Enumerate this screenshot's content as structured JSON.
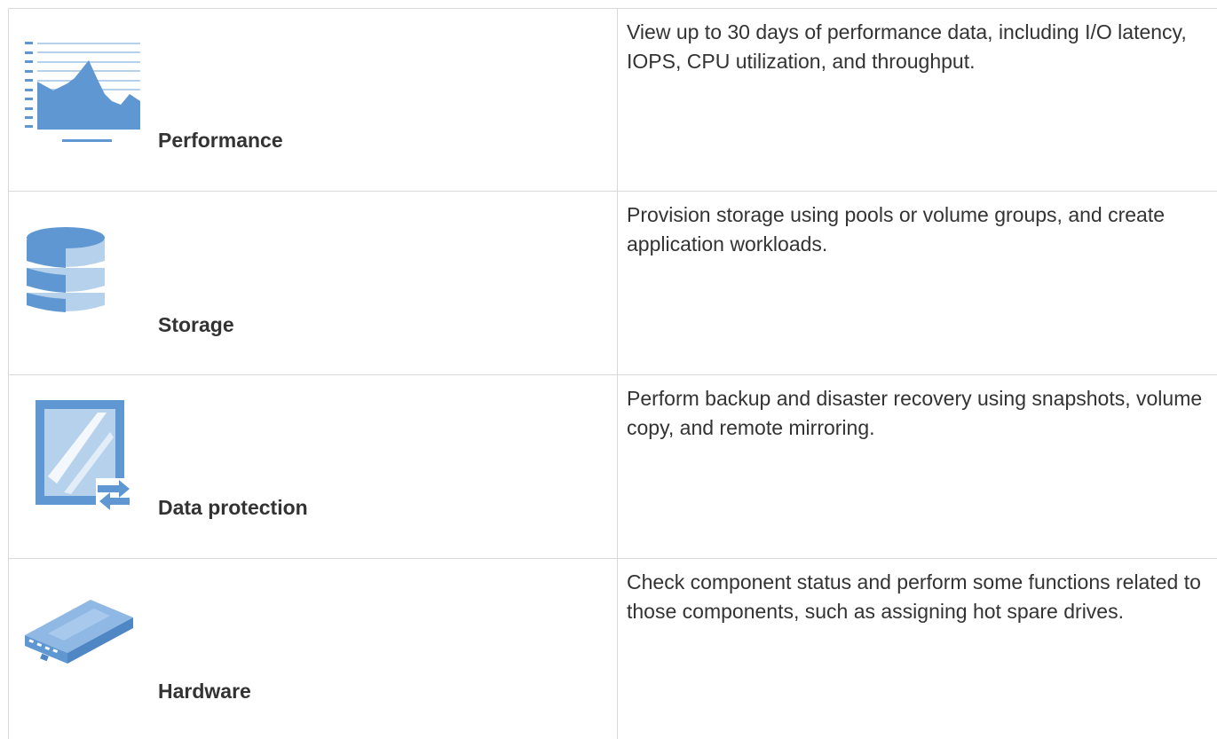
{
  "features": [
    {
      "name": "Performance",
      "icon": "performance-chart-icon",
      "description": "View up to 30 days of performance data, including I/O latency, IOPS, CPU utilization, and throughput."
    },
    {
      "name": "Storage",
      "icon": "storage-stack-icon",
      "description": "Provision storage using pools or volume groups, and create application workloads."
    },
    {
      "name": "Data protection",
      "icon": "data-protection-mirror-icon",
      "description": "Perform backup and disaster recovery using snapshots, volume copy, and remote mirroring."
    },
    {
      "name": "Hardware",
      "icon": "hardware-controller-icon",
      "description": "Check component status and perform some functions related to those components, such as assigning hot spare drives."
    }
  ],
  "colors": {
    "icon_dark": "#5f97d2",
    "icon_light": "#b6d1ec",
    "border": "#d9d9d9",
    "text": "#333333"
  }
}
